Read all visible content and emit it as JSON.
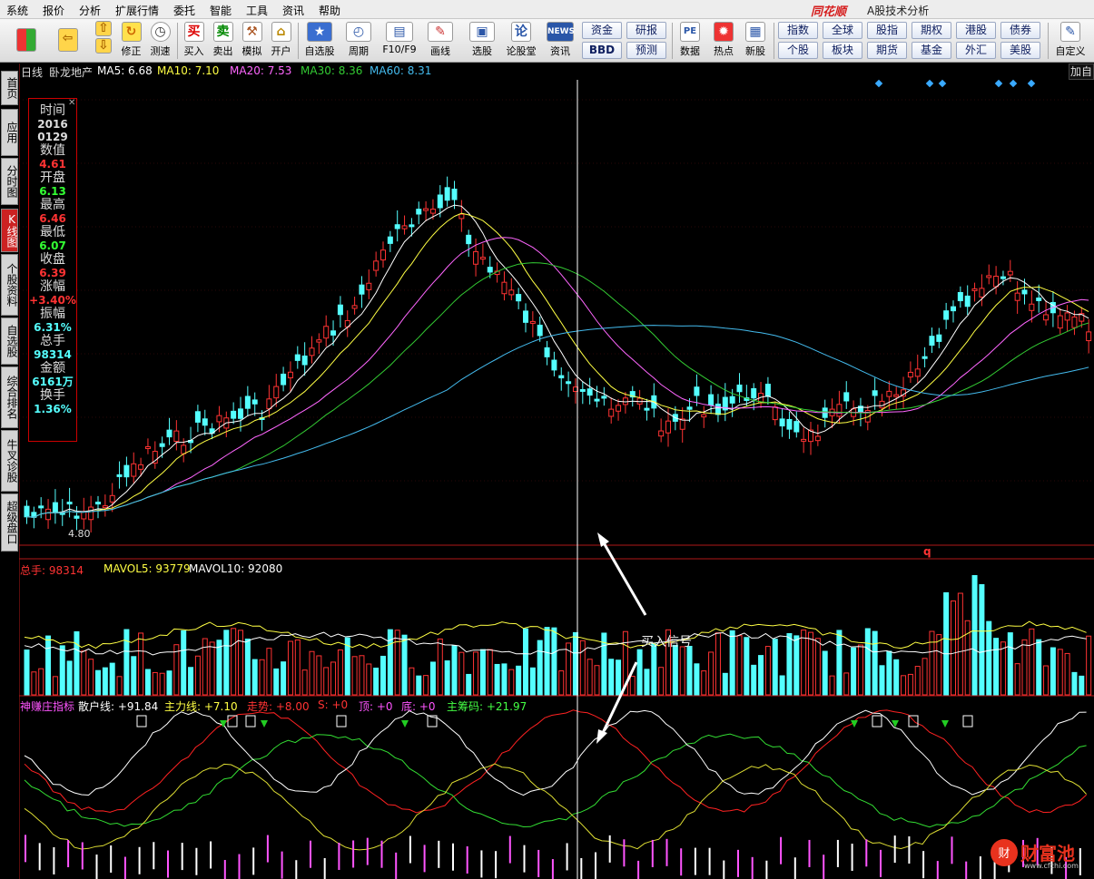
{
  "menu": [
    "系统",
    "报价",
    "分析",
    "扩展行情",
    "委托",
    "智能",
    "工具",
    "资讯",
    "帮助"
  ],
  "brand": "同花顺",
  "app_title": "A股技术分析",
  "toolbar": {
    "repair": "修正",
    "speed": "测速",
    "buy": "买入",
    "sell": "卖出",
    "sim": "模拟",
    "open": "开户",
    "watch": "自选股",
    "period": "周期",
    "f10": "F10/F9",
    "draw": "画线",
    "pick": "选股",
    "forum": "论股堂",
    "news": "资讯",
    "data": "数据",
    "hot": "热点",
    "newstock": "新股",
    "custom": "自定义",
    "buy_glyph": "买",
    "sell_glyph": "卖",
    "news_glyph": "NEWS"
  },
  "quick": {
    "r1": [
      "资金",
      "研报",
      "指数",
      "全球",
      "股指",
      "期权",
      "港股",
      "债券"
    ],
    "r2": [
      "BBD",
      "预测",
      "个股",
      "板块",
      "期货",
      "基金",
      "外汇",
      "美股"
    ]
  },
  "side": [
    "首页",
    "应用",
    "分时图",
    "K线图",
    "个股资料",
    "自选股",
    "综合排名",
    "牛叉诊股",
    "超级盘口"
  ],
  "kline": {
    "period": "日线",
    "name": "卧龙地产",
    "ma5": "MA5: 6.68",
    "ma10": "MA10: 7.10",
    "ma20": "MA20: 7.53",
    "ma30": "MA30: 8.36",
    "ma60": "MA60: 8.31",
    "low_label": "4.80",
    "q_label": "q"
  },
  "info": {
    "time_l": "时间",
    "year": "2016",
    "date": "0129",
    "val_l": "数值",
    "val": "4.61",
    "open_l": "开盘",
    "open": "6.13",
    "high_l": "最高",
    "high": "6.46",
    "low_l": "最低",
    "low": "6.07",
    "close_l": "收盘",
    "close": "6.39",
    "chg_l": "涨幅",
    "chg": "+3.40%",
    "amp_l": "振幅",
    "amp": "6.31%",
    "vol_l": "总手",
    "vol": "98314",
    "amt_l": "金额",
    "amt": "6161万",
    "turn_l": "换手",
    "turn": "1.36%"
  },
  "volume": {
    "total": "总手: 98314",
    "mavol5": "MAVOL5: 93779",
    "mavol10": "MAVOL10: 92080"
  },
  "indicator": {
    "name": "神赚庄指标",
    "retail": "散户线: +91.84",
    "main": "主力线: +7.10",
    "trend": "走势: +8.00",
    "s": "S: +0",
    "top": "顶: +0",
    "bottom": "底: +0",
    "chip": "主筹码: +21.97"
  },
  "add_btn": "加自",
  "signal_text": "买入信号",
  "watermark": "财富池",
  "watermark_url": "www.cfchi.com",
  "colors": {
    "up": "#ff3333",
    "down": "#54ffff",
    "ma5": "#ffffff",
    "ma10": "#ffff44",
    "ma20": "#ff66ff",
    "ma30": "#33cc33",
    "ma60": "#44bbee"
  }
}
